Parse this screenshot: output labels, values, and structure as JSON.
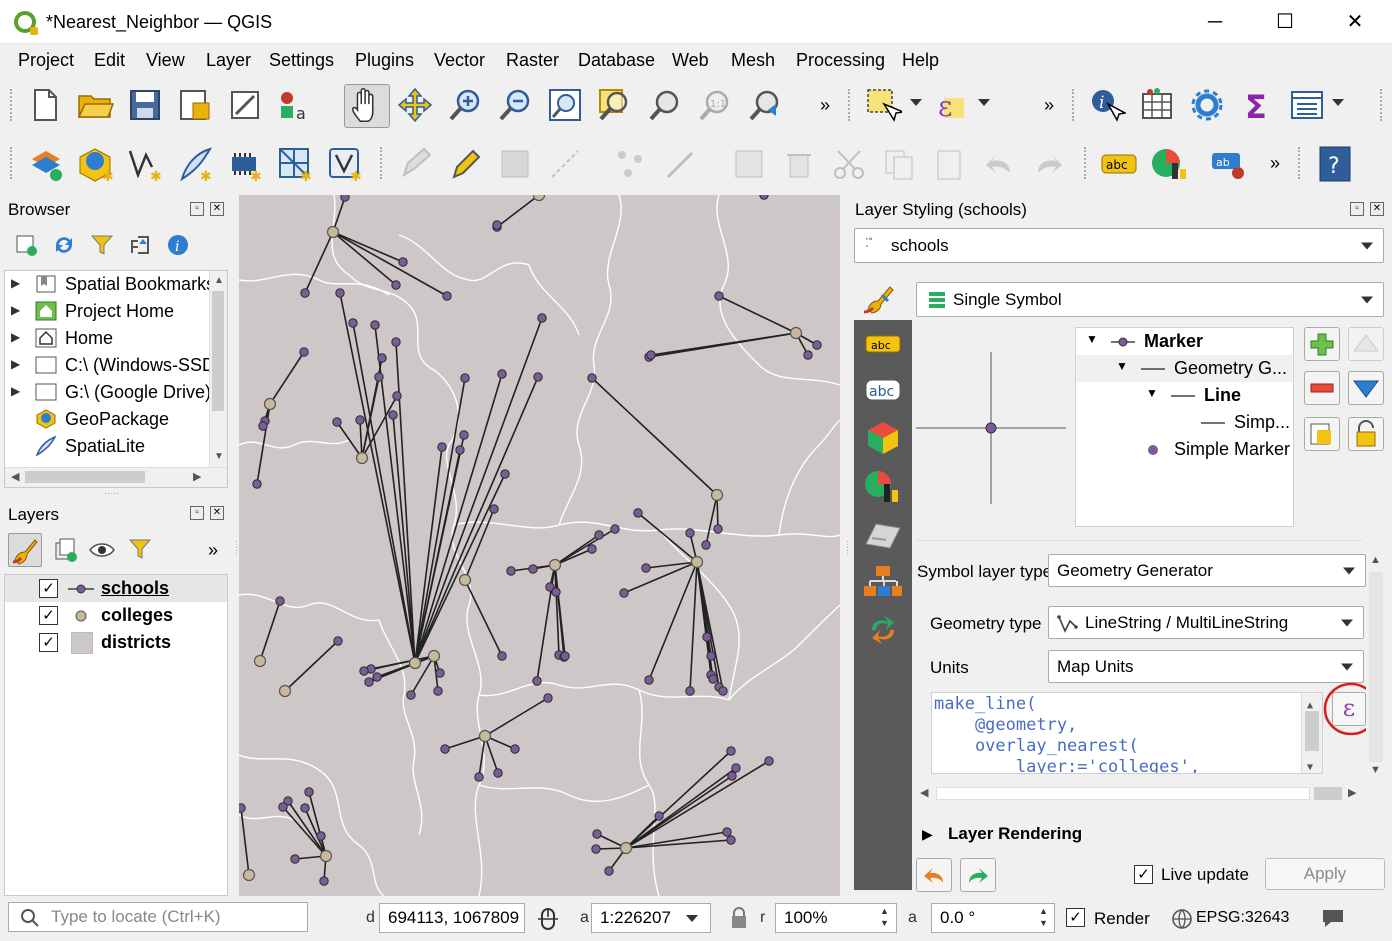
{
  "window": {
    "title": "*Nearest_Neighbor — QGIS",
    "minimize": "─",
    "maximize": "☐",
    "close": "✕"
  },
  "menu": [
    "Project",
    "Edit",
    "View",
    "Layer",
    "Settings",
    "Plugins",
    "Vector",
    "Raster",
    "Database",
    "Web",
    "Mesh",
    "Processing",
    "Help"
  ],
  "browser": {
    "title": "Browser",
    "items": [
      {
        "label": "Spatial Bookmarks",
        "icon": "bookmark-folder-icon",
        "expandable": true
      },
      {
        "label": "Project Home",
        "icon": "project-home-icon",
        "expandable": true
      },
      {
        "label": "Home",
        "icon": "home-folder-icon",
        "expandable": true
      },
      {
        "label": "C:\\ (Windows-SSD)",
        "icon": "drive-icon",
        "expandable": true
      },
      {
        "label": "G:\\ (Google Drive)",
        "icon": "drive-icon",
        "expandable": true
      },
      {
        "label": "GeoPackage",
        "icon": "geopackage-icon",
        "expandable": false
      },
      {
        "label": "SpatiaLite",
        "icon": "spatialite-icon",
        "expandable": false
      }
    ]
  },
  "layers": {
    "title": "Layers",
    "items": [
      {
        "label": "schools",
        "checked": true,
        "symbol": "line-marker",
        "selected": true
      },
      {
        "label": "colleges",
        "checked": true,
        "symbol": "point"
      },
      {
        "label": "districts",
        "checked": true,
        "symbol": "polygon"
      }
    ],
    "check_mark": "✓"
  },
  "styling": {
    "title": "Layer Styling (schools)",
    "layer_combo": "schools",
    "renderer_combo": "Single Symbol",
    "tree": {
      "marker": "Marker",
      "geometry_generator": "Geometry G...",
      "line": "Line",
      "simple_line": "Simp...",
      "simple_marker": "Simple Marker"
    },
    "symbol_layer_type_label": "Symbol layer type",
    "symbol_layer_type": "Geometry Generator",
    "geometry_type_label": "Geometry type",
    "geometry_type": "LineString / MultiLineString",
    "units_label": "Units",
    "units": "Map Units",
    "code_lines": [
      "make_line(",
      "    @geometry,",
      "    overlay_nearest(",
      "        layer:='colleges',"
    ],
    "expression_button": "ε",
    "layer_rendering": "Layer Rendering",
    "live_update_label": "Live update",
    "live_update_checked": true,
    "apply_label": "Apply"
  },
  "status": {
    "locator_placeholder": "Type to locate (Ctrl+K)",
    "coordinate": "694113, 1067809",
    "scale": "1:226207",
    "magnifier": "100%",
    "rotation": "0.0 °",
    "render_label": "Render",
    "crs": "EPSG:32643",
    "coord_prefix": "d",
    "scale_prefix": "a",
    "mag_prefix": "r",
    "rot_prefix": "a"
  },
  "colors": {
    "map_bg": "#cdc7c7",
    "school": "#7b5c98",
    "college": "#c7b99a",
    "line": "#222222",
    "boundary": "#ffffff",
    "highlight_circle": "#d62020"
  }
}
